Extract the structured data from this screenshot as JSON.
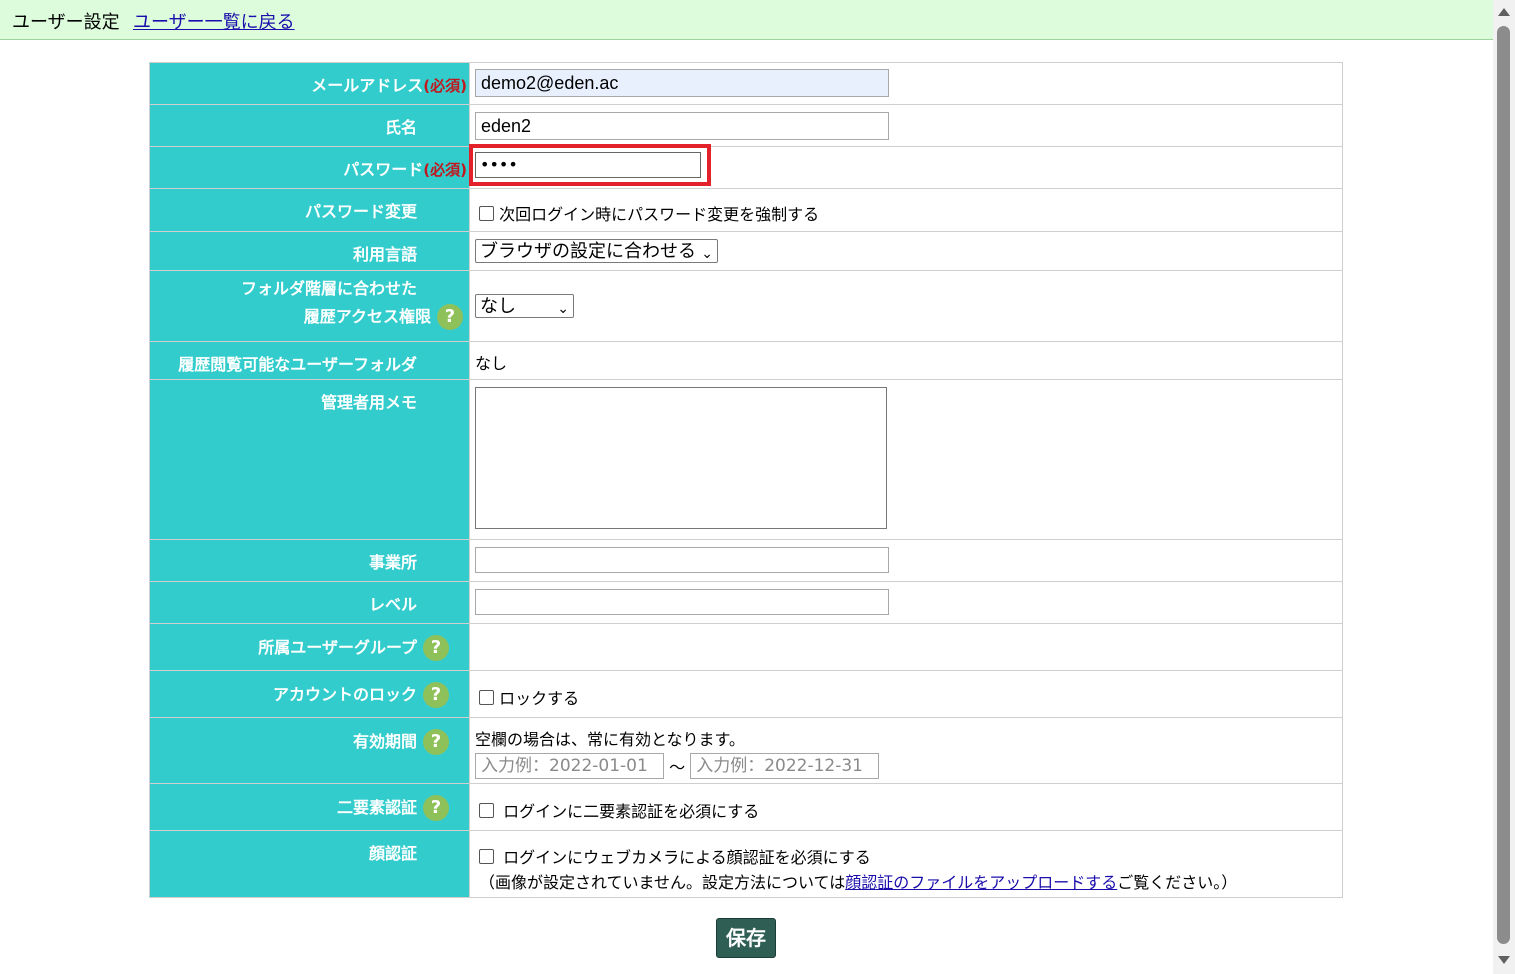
{
  "header": {
    "title": "ユーザー設定",
    "back_link": "ユーザー一覧に戻る"
  },
  "required_mark": "(必須)",
  "help_icon": "?",
  "fields": {
    "email": {
      "label": "メールアドレス",
      "value": "demo2@eden.ac"
    },
    "name": {
      "label": "氏名",
      "value": "eden2"
    },
    "password": {
      "label": "パスワード",
      "value": "••••"
    },
    "password_change": {
      "label": "パスワード変更",
      "checkbox_label": "次回ログイン時にパスワード変更を強制する"
    },
    "language": {
      "label": "利用言語",
      "selected": "ブラウザの設定に合わせる"
    },
    "folder_access": {
      "label_line1": "フォルダ階層に合わせた",
      "label_line2": "履歴アクセス権限",
      "selected": "なし"
    },
    "history_folders": {
      "label": "履歴閲覧可能なユーザーフォルダ",
      "value": "なし"
    },
    "admin_memo": {
      "label": "管理者用メモ",
      "value": ""
    },
    "office": {
      "label": "事業所",
      "value": ""
    },
    "level": {
      "label": "レベル",
      "value": ""
    },
    "user_group": {
      "label": "所属ユーザーグループ"
    },
    "account_lock": {
      "label": "アカウントのロック",
      "checkbox_label": "ロックする"
    },
    "validity": {
      "label": "有効期間",
      "note": "空欄の場合は、常に有効となります。",
      "from_placeholder": "入力例：2022-01-01",
      "separator": "～",
      "to_placeholder": "入力例：2022-12-31"
    },
    "two_factor": {
      "label": "二要素認証",
      "checkbox_label": "ログインに二要素認証を必須にする"
    },
    "face_auth": {
      "label": "顔認証",
      "checkbox_label": "ログインにウェブカメラによる顔認証を必須にする",
      "note_prefix": "（画像が設定されていません。設定方法については",
      "note_link": "顔認証のファイルをアップロードする",
      "note_suffix": "ご覧ください。）"
    }
  },
  "save_button": "保存",
  "colors": {
    "label_bg": "#33cccc",
    "header_bg": "#dcfcdc",
    "required": "#c0181e",
    "help": "#8fc15a",
    "highlight": "#e3212b",
    "save_bg": "#2f5f54"
  }
}
